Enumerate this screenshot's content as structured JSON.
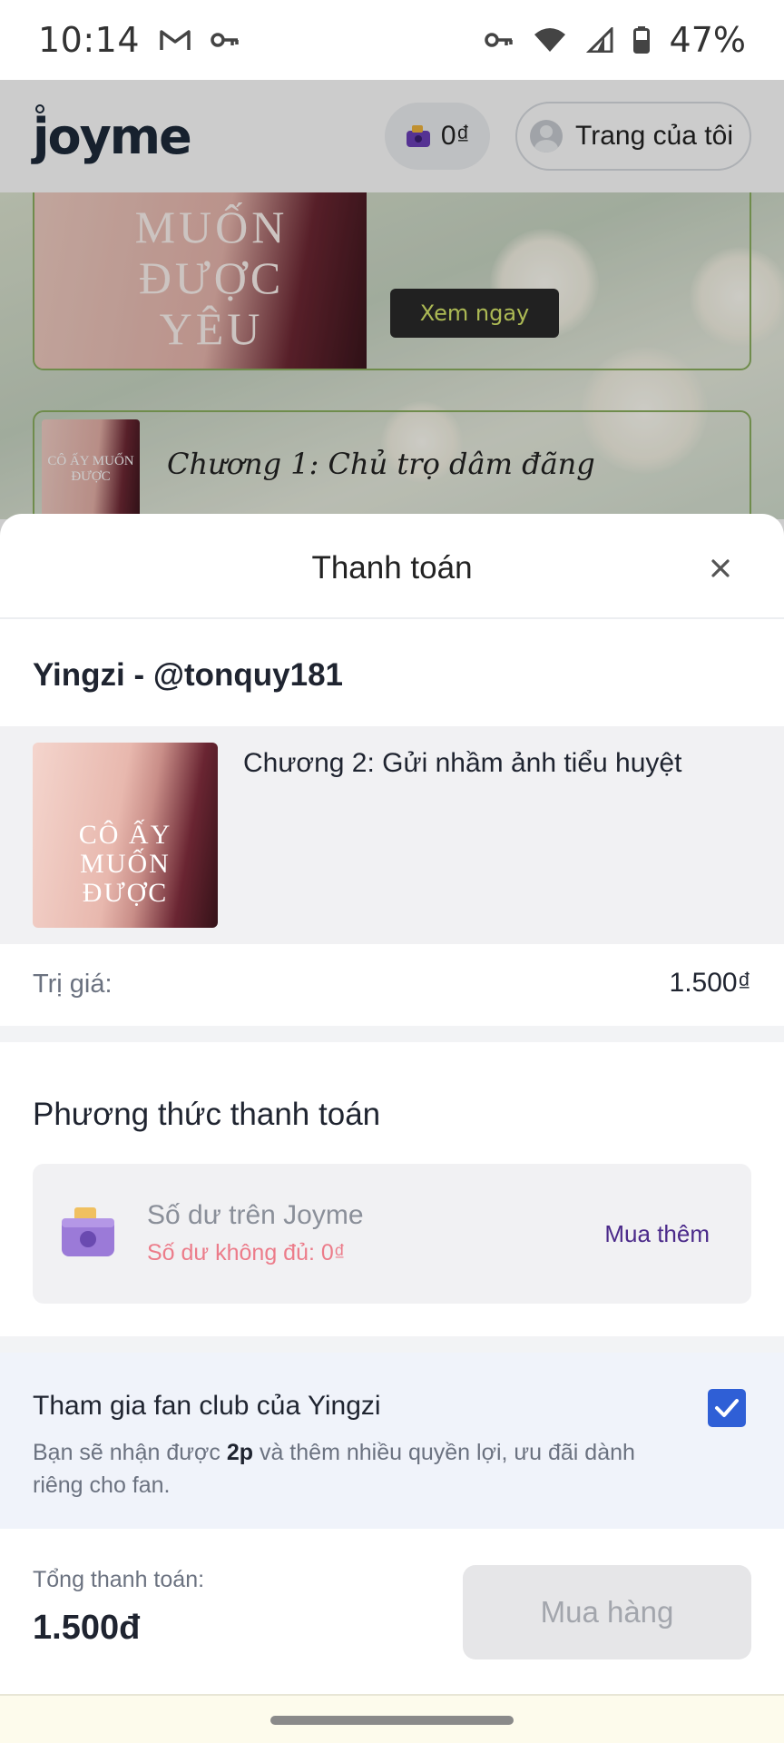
{
  "status_bar": {
    "time": "10:14",
    "battery": "47%",
    "icons": [
      "gmail-icon",
      "vpn-key-icon",
      "vpn-key-icon",
      "wifi-icon",
      "signal-icon",
      "battery-icon"
    ]
  },
  "header": {
    "logo": "joyme",
    "wallet_balance": "0₫",
    "my_page_label": "Trang của tôi"
  },
  "background": {
    "cover_text": "MUỐN ĐƯỢC YÊU",
    "view_button": "Xem ngay",
    "chapter_cover_text": "CÔ ẤY MUỐN ĐƯỢC",
    "chapter_title": "Chương 1: Chủ trọ dâm đãng"
  },
  "sheet": {
    "title": "Thanh toán",
    "creator": "Yingzi - @tonquy181",
    "item": {
      "cover_text": "CÔ ẤY MUỐN ĐƯỢC",
      "title": "Chương 2: Gửi nhầm ảnh tiểu huyệt"
    },
    "price": {
      "label": "Trị giá:",
      "value": "1.500₫"
    },
    "payment": {
      "section_title": "Phương thức thanh toán",
      "method_name": "Số dư trên Joyme",
      "warning": "Số dư không đủ: 0₫",
      "buy_more": "Mua thêm"
    },
    "fan_club": {
      "title": "Tham gia fan club của Yingzi",
      "desc_prefix": "Bạn sẽ nhận được ",
      "desc_points": "2p",
      "desc_suffix": " và thêm nhiều quyền lợi, ưu đãi dành riêng cho fan.",
      "checked": true
    },
    "total": {
      "label": "Tổng thanh toán:",
      "value": "1.500đ"
    },
    "buy_button": "Mua hàng"
  },
  "colors": {
    "accent_purple": "#4b2a8a",
    "warning_pink": "#ec7c8a",
    "checkbox_blue": "#2f5fd6",
    "fan_bg": "#f0f3fa"
  }
}
